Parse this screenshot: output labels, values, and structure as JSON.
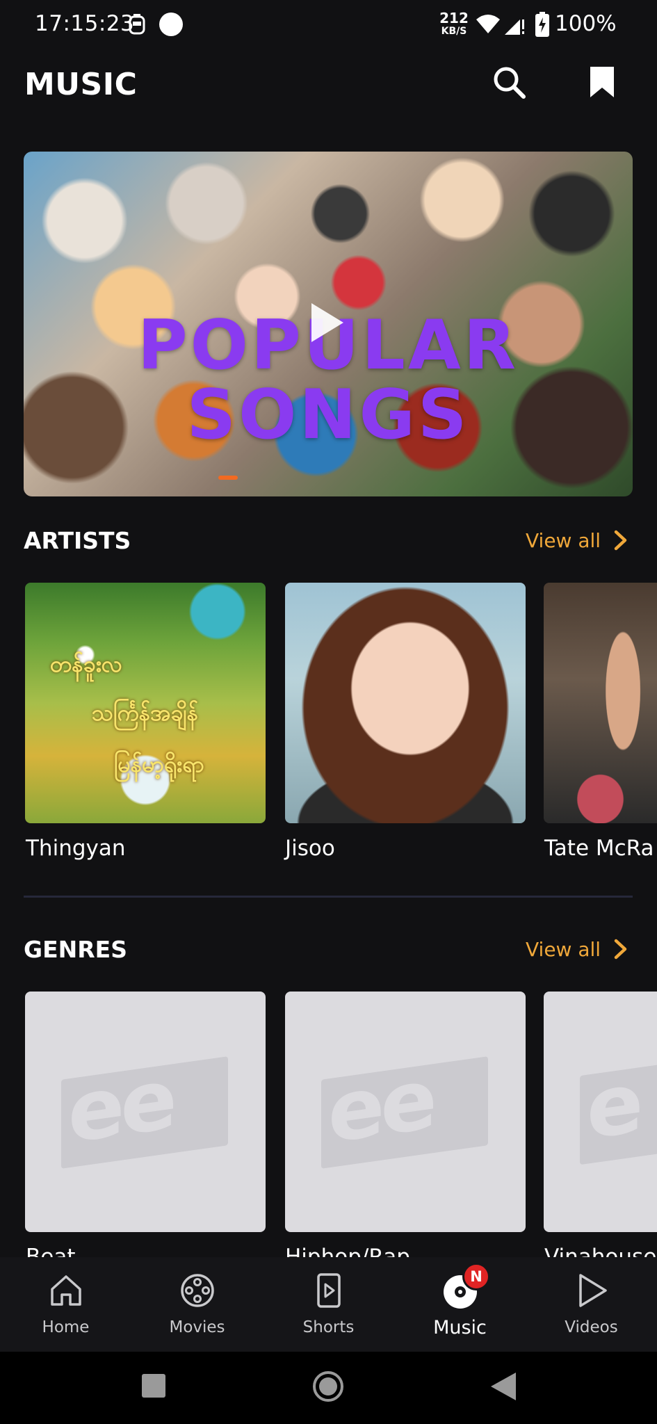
{
  "status_bar": {
    "time": "17:15:23",
    "net_speed_value": "212",
    "net_speed_unit": "KB/S",
    "battery": "100%"
  },
  "header": {
    "title": "MUSIC",
    "search_icon": "search-icon",
    "bookmark_icon": "bookmark-icon"
  },
  "banner": {
    "line1": "POPULAR",
    "line2": "SONGS",
    "accent": "#8a3bf0"
  },
  "artists": {
    "title": "ARTISTS",
    "view_all": "View all",
    "items": [
      {
        "label": "Thingyan",
        "art_text": [
          "တန်ခူးလ",
          "သင်္ကြန်အချိန်",
          "မြန်မာ့ရိုးရာ"
        ]
      },
      {
        "label": "Jisoo"
      },
      {
        "label": "Tate McRa"
      }
    ]
  },
  "genres": {
    "title": "GENRES",
    "view_all": "View all",
    "items": [
      {
        "label": "Beat",
        "placeholder": "ee"
      },
      {
        "label": "Hiphop/Rap",
        "placeholder": "ee"
      },
      {
        "label": "Vinahouse",
        "placeholder": "e"
      }
    ]
  },
  "bottom_nav": {
    "items": [
      {
        "label": "Home",
        "icon": "home-icon"
      },
      {
        "label": "Movies",
        "icon": "film-reel-icon"
      },
      {
        "label": "Shorts",
        "icon": "shorts-icon"
      },
      {
        "label": "Music",
        "icon": "music-disc-icon",
        "active": true,
        "badge": "N"
      },
      {
        "label": "Videos",
        "icon": "play-icon"
      }
    ]
  },
  "colors": {
    "background": "#111113",
    "accent_orange": "#f0a83a",
    "badge_red": "#e02424"
  }
}
